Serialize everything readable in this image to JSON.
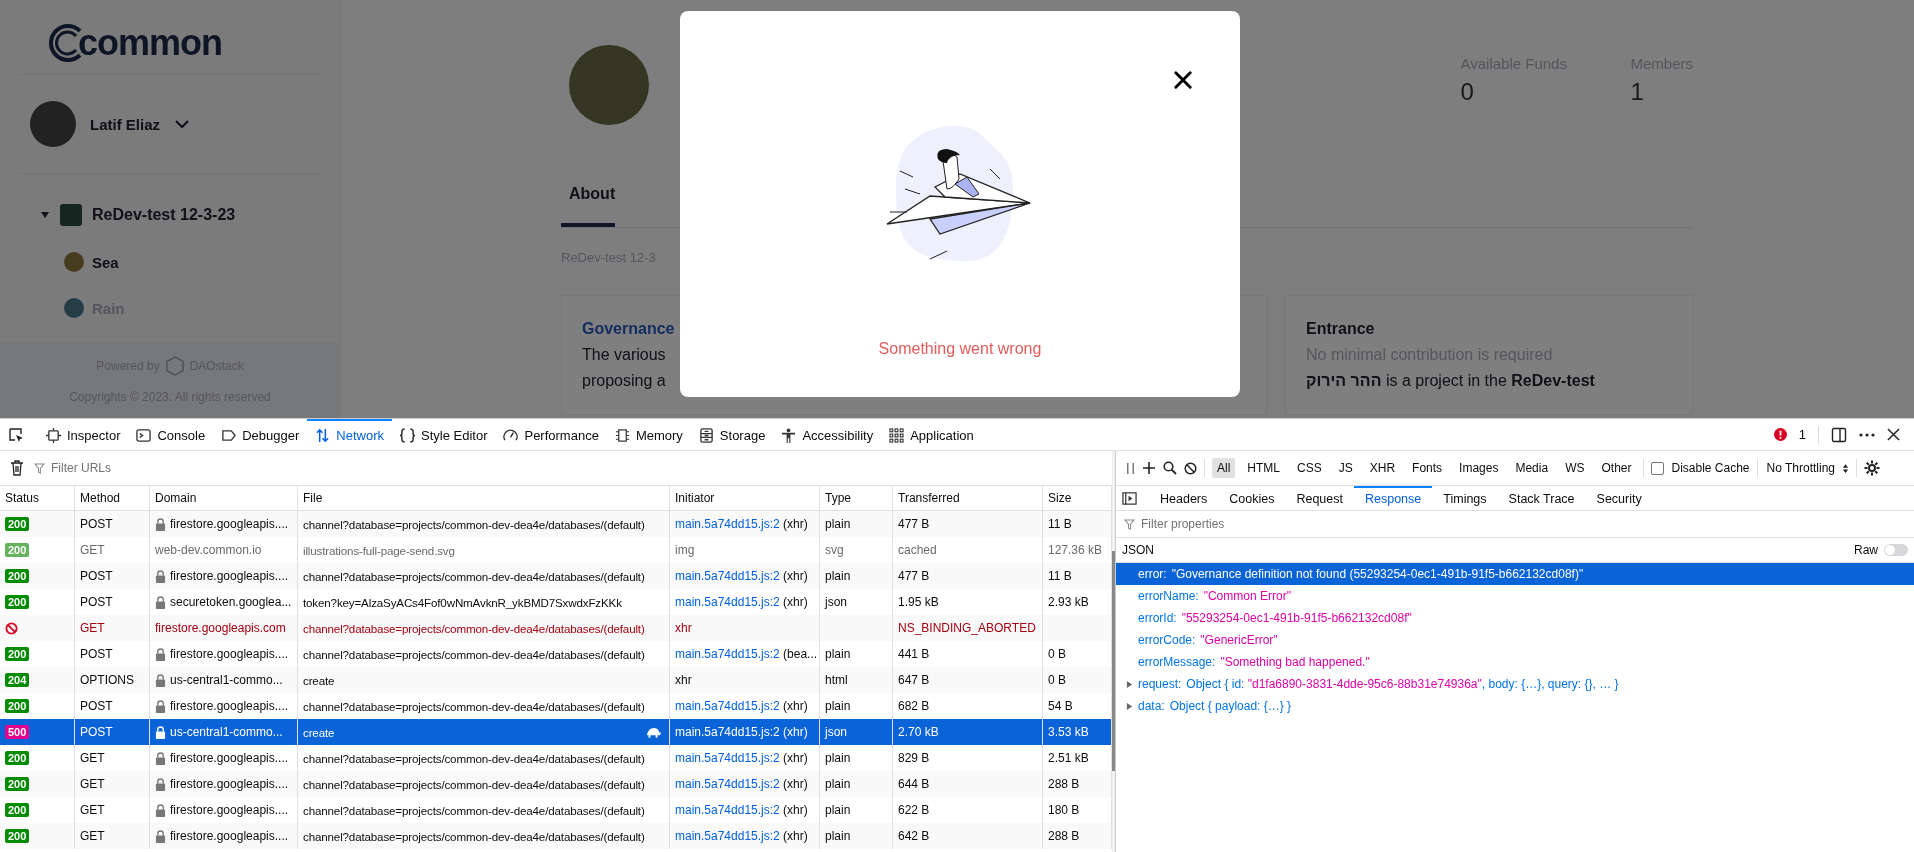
{
  "app": {
    "logo": "common",
    "sidebar": {
      "user": {
        "name": "Latif Eliaz"
      },
      "tree": [
        {
          "label": "ReDev-test 12-3-23",
          "expanded": true,
          "children": [
            {
              "label": "Sea"
            },
            {
              "label": "Rain"
            }
          ]
        }
      ],
      "footer": {
        "powered_by": "Powered by",
        "brand": "DAOstack",
        "copyright": "Copyrights © 2023. All rights reserved"
      }
    },
    "main": {
      "stats": [
        {
          "label": "Available Funds",
          "value": "0"
        },
        {
          "label": "Members",
          "value": "1"
        }
      ],
      "tabs": [
        {
          "label": "About",
          "selected": true
        }
      ],
      "subtitle": "ReDev-test 12-3",
      "governance_card": {
        "title": "Governance",
        "lines": [
          "The various",
          "proposing a"
        ]
      },
      "entrance_card": {
        "title": "Entrance",
        "note": "No minimal contribution is required",
        "text": "**ההר הירוק** is a project in the **ReDev-test**"
      }
    }
  },
  "modal": {
    "message": "Something went wrong"
  },
  "devtools": {
    "tabs": [
      {
        "label": "Inspector",
        "selected": false
      },
      {
        "label": "Console",
        "selected": false
      },
      {
        "label": "Debugger",
        "selected": false
      },
      {
        "label": "Network",
        "selected": true
      },
      {
        "label": "Style Editor",
        "selected": false
      },
      {
        "label": "Performance",
        "selected": false
      },
      {
        "label": "Memory",
        "selected": false
      },
      {
        "label": "Storage",
        "selected": false
      },
      {
        "label": "Accessibility",
        "selected": false
      },
      {
        "label": "Application",
        "selected": false
      }
    ],
    "error_count": "1",
    "filter_placeholder": "Filter URLs",
    "type_filters": [
      {
        "label": "All",
        "selected": true
      },
      {
        "label": "HTML",
        "selected": false
      },
      {
        "label": "CSS",
        "selected": false
      },
      {
        "label": "JS",
        "selected": false
      },
      {
        "label": "XHR",
        "selected": false
      },
      {
        "label": "Fonts",
        "selected": false
      },
      {
        "label": "Images",
        "selected": false
      },
      {
        "label": "Media",
        "selected": false
      },
      {
        "label": "WS",
        "selected": false
      },
      {
        "label": "Other",
        "selected": false
      }
    ],
    "disable_cache": {
      "label": "Disable Cache",
      "checked": false
    },
    "throttling": "No Throttling",
    "table": {
      "columns": [
        "Status",
        "Method",
        "Domain",
        "File",
        "Initiator",
        "Type",
        "Transferred",
        "Size"
      ],
      "rows": [
        {
          "status": "200",
          "kind": "ok",
          "method": "POST",
          "domain": "firestore.googleapis....",
          "secure": true,
          "file": "channel?database=projects/common-dev-dea4e/databases/(default)",
          "initiator": "main.5a74dd15.js:2",
          "initiator_link": true,
          "initiator_note": "(xhr)",
          "type": "plain",
          "transferred": "477 B",
          "size": "11 B",
          "selected": false,
          "slow": false
        },
        {
          "status": "200",
          "kind": "cached",
          "method": "GET",
          "domain": "web-dev.common.io",
          "secure": false,
          "file": "illustrations-full-page-send.svg",
          "initiator": "img",
          "initiator_link": false,
          "type": "svg",
          "transferred": "cached",
          "size": "127.36 kB",
          "selected": false,
          "slow": false
        },
        {
          "status": "200",
          "kind": "ok",
          "method": "POST",
          "domain": "firestore.googleapis....",
          "secure": true,
          "file": "channel?database=projects/common-dev-dea4e/databases/(default)",
          "initiator": "main.5a74dd15.js:2",
          "initiator_link": true,
          "initiator_note": "(xhr)",
          "type": "plain",
          "transferred": "477 B",
          "size": "11 B",
          "selected": false,
          "slow": false
        },
        {
          "status": "200",
          "kind": "ok",
          "method": "POST",
          "domain": "securetoken.googlea...",
          "secure": true,
          "file": "token?key=AlzaSyACs4Fof0wNmAvknR_ykBMD7SxwdxFzKKk",
          "initiator": "main.5a74dd15.js:2",
          "initiator_link": true,
          "initiator_note": "(xhr)",
          "type": "json",
          "transferred": "1.95 kB",
          "size": "2.93 kB",
          "selected": false,
          "slow": false
        },
        {
          "kind": "blocked",
          "method": "GET",
          "domain": "firestore.googleapis.com",
          "secure": false,
          "file": "channel?database=projects/common-dev-dea4e/databases/(default)",
          "initiator": "xhr",
          "initiator_link": false,
          "transferred": "NS_BINDING_ABORTED",
          "selected": false,
          "slow": false
        },
        {
          "status": "200",
          "kind": "ok",
          "method": "POST",
          "domain": "firestore.googleapis....",
          "secure": true,
          "file": "channel?database=projects/common-dev-dea4e/databases/(default)",
          "initiator": "main.5a74dd15.js:2",
          "initiator_link": true,
          "initiator_note": "(bea...",
          "type": "plain",
          "transferred": "441 B",
          "size": "0 B",
          "selected": false,
          "slow": false
        },
        {
          "status": "204",
          "kind": "ok",
          "method": "OPTIONS",
          "domain": "us-central1-commo...",
          "secure": true,
          "file": "create",
          "initiator": "xhr",
          "initiator_link": false,
          "type": "html",
          "transferred": "647 B",
          "size": "0 B",
          "selected": false,
          "slow": false
        },
        {
          "status": "200",
          "kind": "ok",
          "method": "POST",
          "domain": "firestore.googleapis....",
          "secure": true,
          "file": "channel?database=projects/common-dev-dea4e/databases/(default)",
          "initiator": "main.5a74dd15.js:2",
          "initiator_link": true,
          "initiator_note": "(xhr)",
          "type": "plain",
          "transferred": "682 B",
          "size": "54 B",
          "selected": false,
          "slow": false
        },
        {
          "status": "500",
          "kind": "server-error",
          "method": "POST",
          "domain": "us-central1-commo...",
          "secure": true,
          "file": "create",
          "initiator": "main.5a74dd15.js:2",
          "initiator_link": true,
          "initiator_note": "(xhr)",
          "type": "json",
          "transferred": "2.70 kB",
          "size": "3.53 kB",
          "selected": true,
          "slow": true
        },
        {
          "status": "200",
          "kind": "ok",
          "method": "GET",
          "domain": "firestore.googleapis....",
          "secure": true,
          "file": "channel?database=projects/common-dev-dea4e/databases/(default)",
          "initiator": "main.5a74dd15.js:2",
          "initiator_link": true,
          "initiator_note": "(xhr)",
          "type": "plain",
          "transferred": "829 B",
          "size": "2.51 kB",
          "selected": false,
          "slow": false
        },
        {
          "status": "200",
          "kind": "ok",
          "method": "GET",
          "domain": "firestore.googleapis....",
          "secure": true,
          "file": "channel?database=projects/common-dev-dea4e/databases/(default)",
          "initiator": "main.5a74dd15.js:2",
          "initiator_link": true,
          "initiator_note": "(xhr)",
          "type": "plain",
          "transferred": "644 B",
          "size": "288 B",
          "selected": false,
          "slow": false
        },
        {
          "status": "200",
          "kind": "ok",
          "method": "GET",
          "domain": "firestore.googleapis....",
          "secure": true,
          "file": "channel?database=projects/common-dev-dea4e/databases/(default)",
          "initiator": "main.5a74dd15.js:2",
          "initiator_link": true,
          "initiator_note": "(xhr)",
          "type": "plain",
          "transferred": "622 B",
          "size": "180 B",
          "selected": false,
          "slow": false
        },
        {
          "status": "200",
          "kind": "ok",
          "method": "GET",
          "domain": "firestore.googleapis....",
          "secure": true,
          "file": "channel?database=projects/common-dev-dea4e/databases/(default)",
          "initiator": "main.5a74dd15.js:2",
          "initiator_link": true,
          "initiator_note": "(xhr)",
          "type": "plain",
          "transferred": "642 B",
          "size": "288 B",
          "selected": false,
          "slow": false
        }
      ]
    },
    "details": {
      "tabs": [
        {
          "label": "Headers",
          "selected": false
        },
        {
          "label": "Cookies",
          "selected": false
        },
        {
          "label": "Request",
          "selected": false
        },
        {
          "label": "Response",
          "selected": true
        },
        {
          "label": "Timings",
          "selected": false
        },
        {
          "label": "Stack Trace",
          "selected": false
        },
        {
          "label": "Security",
          "selected": false
        }
      ],
      "filter_placeholder": "Filter properties",
      "section": "JSON",
      "raw": {
        "label": "Raw",
        "on": false
      },
      "properties": [
        {
          "kind": "value",
          "key": "error:",
          "value": "\"Governance definition not found (55293254-0ec1-491b-91f5-b662132cd08f)\"",
          "selected": true
        },
        {
          "kind": "value",
          "key": "errorName:",
          "value": "\"Common Error\"",
          "selected": false
        },
        {
          "kind": "value",
          "key": "errorId:",
          "value": "\"55293254-0ec1-491b-91f5-b662132cd08f\"",
          "selected": false
        },
        {
          "kind": "value",
          "key": "errorCode:",
          "value": "\"GenericError\"",
          "selected": false
        },
        {
          "kind": "value",
          "key": "errorMessage:",
          "value": "\"Something bad happened.\"",
          "selected": false
        },
        {
          "kind": "object",
          "key": "request:",
          "expanded": false,
          "parts": [
            {
              "kind": "plain",
              "text": "Object { id: "
            },
            {
              "kind": "string",
              "text": "\"d1fa6890-3831-4dde-95c6-88b31e74936a\""
            },
            {
              "kind": "plain",
              "text": ", body: {…}, query: {}, … }"
            }
          ],
          "selected": false
        },
        {
          "kind": "object",
          "key": "data:",
          "expanded": false,
          "parts": [
            {
              "kind": "plain",
              "text": "Object { payload: {…} }"
            }
          ],
          "selected": false
        }
      ]
    }
  }
}
